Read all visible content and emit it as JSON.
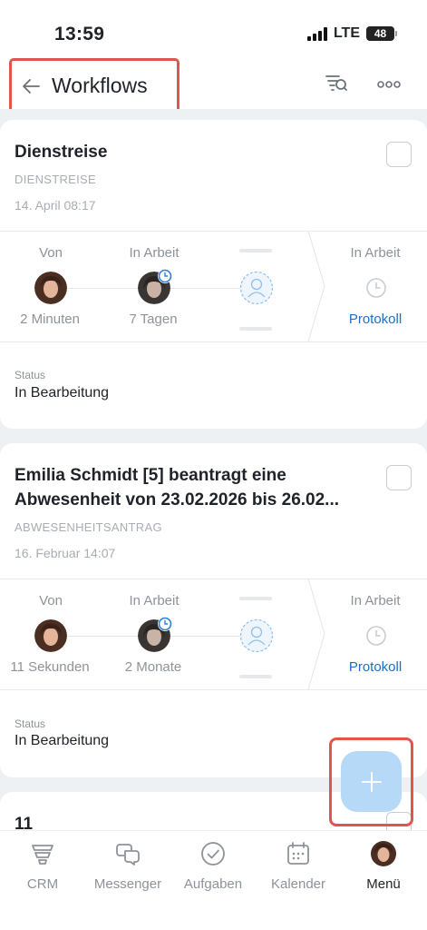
{
  "status_bar": {
    "time": "13:59",
    "network": "LTE",
    "battery": "48"
  },
  "header": {
    "title": "Workflows"
  },
  "cards": [
    {
      "title_lines": [
        "Dienstreise"
      ],
      "type": "DIENSTREISE",
      "date": "14. April 08:17",
      "flow": {
        "from_label": "Von",
        "from_time": "2 Minuten",
        "work_label": "In Arbeit",
        "work_time": "7 Tagen",
        "right_label": "In Arbeit",
        "right_link": "Protokoll"
      },
      "status_label": "Status",
      "status_value": "In Bearbeitung"
    },
    {
      "title_lines": [
        "Emilia Schmidt [5] beantragt eine",
        "Abwesenheit von 23.02.2026 bis 26.02..."
      ],
      "type": "ABWESENHEITSANTRAG",
      "date": "16. Februar 14:07",
      "flow": {
        "from_label": "Von",
        "from_time": "11 Sekunden",
        "work_label": "In Arbeit",
        "work_time": "2 Monate",
        "right_label": "In Arbeit",
        "right_link": "Protokoll"
      },
      "status_label": "Status",
      "status_value": "In Bearbeitung"
    },
    {
      "title_lines": [
        "11"
      ]
    }
  ],
  "tabs": [
    {
      "label": "CRM",
      "icon": "crm-icon",
      "active": false
    },
    {
      "label": "Messenger",
      "icon": "chat-icon",
      "active": false
    },
    {
      "label": "Aufgaben",
      "icon": "check-circle-icon",
      "active": false
    },
    {
      "label": "Kalender",
      "icon": "calendar-icon",
      "active": false
    },
    {
      "label": "Menü",
      "icon": "avatar",
      "active": true
    }
  ],
  "colors": {
    "accent": "#1d6ec4",
    "fab": "#b7d9f8",
    "highlight": "#e0554d"
  }
}
